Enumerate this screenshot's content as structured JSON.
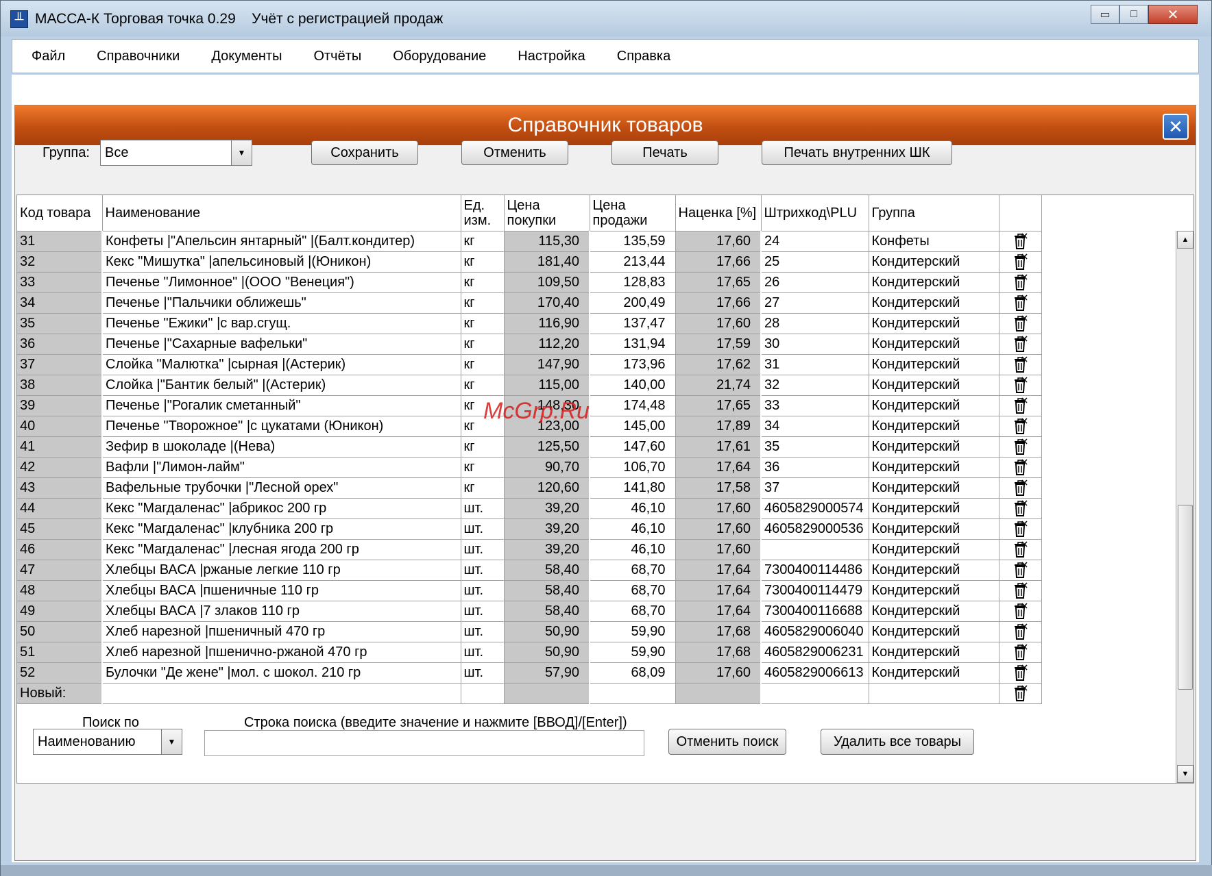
{
  "window": {
    "title": "МАССА-К Торговая точка 0.29    Учёт с регистрацией продаж",
    "app_icon_glyph": "╨",
    "controls": {
      "minimize": "▭",
      "maximize": "□",
      "close": "✕"
    }
  },
  "menu": [
    "Файл",
    "Справочники",
    "Документы",
    "Отчёты",
    "Оборудование",
    "Настройка",
    "Справка"
  ],
  "panel": {
    "title": "Справочник товаров",
    "close_glyph": "✕",
    "header_color": "#c24f12"
  },
  "toolbar": {
    "group_label": "Группа:",
    "group_value": "Все",
    "save_label": "Сохранить",
    "cancel_label": "Отменить",
    "print_label": "Печать",
    "print_barcodes_label": "Печать внутренних ШК"
  },
  "table": {
    "columns": [
      "Код товара",
      "Наименование",
      "Ед. изм.",
      "Цена покупки",
      "Цена продажи",
      "Наценка [%]",
      "Штрихкод\\PLU",
      "Группа",
      ""
    ],
    "rows": [
      {
        "code": "31",
        "name": "Конфеты |\"Апельсин янтарный\" |(Балт.кондитер)",
        "unit": "кг",
        "buy": "115,30",
        "sell": "135,59",
        "markup": "17,60",
        "barcode": "24",
        "group": "Конфеты"
      },
      {
        "code": "32",
        "name": "Кекс \"Мишутка\" |апельсиновый |(Юникон)",
        "unit": "кг",
        "buy": "181,40",
        "sell": "213,44",
        "markup": "17,66",
        "barcode": "25",
        "group": "Кондитерский"
      },
      {
        "code": "33",
        "name": "Печенье \"Лимонное\" |(ООО \"Венеция\")",
        "unit": "кг",
        "buy": "109,50",
        "sell": "128,83",
        "markup": "17,65",
        "barcode": "26",
        "group": "Кондитерский"
      },
      {
        "code": "34",
        "name": "Печенье |\"Пальчики оближешь\"",
        "unit": "кг",
        "buy": "170,40",
        "sell": "200,49",
        "markup": "17,66",
        "barcode": "27",
        "group": "Кондитерский"
      },
      {
        "code": "35",
        "name": "Печенье \"Ежики\" |с вар.сгущ.",
        "unit": "кг",
        "buy": "116,90",
        "sell": "137,47",
        "markup": "17,60",
        "barcode": "28",
        "group": "Кондитерский"
      },
      {
        "code": "36",
        "name": "Печенье |\"Сахарные вафельки\"",
        "unit": "кг",
        "buy": "112,20",
        "sell": "131,94",
        "markup": "17,59",
        "barcode": "30",
        "group": "Кондитерский"
      },
      {
        "code": "37",
        "name": "Слойка \"Малютка\" |сырная |(Астерик)",
        "unit": "кг",
        "buy": "147,90",
        "sell": "173,96",
        "markup": "17,62",
        "barcode": "31",
        "group": "Кондитерский"
      },
      {
        "code": "38",
        "name": "Слойка |\"Бантик белый\" |(Астерик)",
        "unit": "кг",
        "buy": "115,00",
        "sell": "140,00",
        "markup": "21,74",
        "barcode": "32",
        "group": "Кондитерский"
      },
      {
        "code": "39",
        "name": "Печенье |\"Рогалик сметанный\"",
        "unit": "кг",
        "buy": "148,30",
        "sell": "174,48",
        "markup": "17,65",
        "barcode": "33",
        "group": "Кондитерский"
      },
      {
        "code": "40",
        "name": "Печенье \"Творожное\" |с цукатами (Юникон)",
        "unit": "кг",
        "buy": "123,00",
        "sell": "145,00",
        "markup": "17,89",
        "barcode": "34",
        "group": "Кондитерский"
      },
      {
        "code": "41",
        "name": "Зефир в шоколаде |(Нева)",
        "unit": "кг",
        "buy": "125,50",
        "sell": "147,60",
        "markup": "17,61",
        "barcode": "35",
        "group": "Кондитерский"
      },
      {
        "code": "42",
        "name": "Вафли |\"Лимон-лайм\"",
        "unit": "кг",
        "buy": "90,70",
        "sell": "106,70",
        "markup": "17,64",
        "barcode": "36",
        "group": "Кондитерский"
      },
      {
        "code": "43",
        "name": "Вафельные трубочки |\"Лесной орех\"",
        "unit": "кг",
        "buy": "120,60",
        "sell": "141,80",
        "markup": "17,58",
        "barcode": "37",
        "group": "Кондитерский"
      },
      {
        "code": "44",
        "name": "Кекс \"Магдаленас\" |абрикос 200 гр",
        "unit": "шт.",
        "buy": "39,20",
        "sell": "46,10",
        "markup": "17,60",
        "barcode": "4605829000574",
        "group": "Кондитерский"
      },
      {
        "code": "45",
        "name": "Кекс \"Магдаленас\" |клубника 200 гр",
        "unit": "шт.",
        "buy": "39,20",
        "sell": "46,10",
        "markup": "17,60",
        "barcode": "4605829000536",
        "group": "Кондитерский"
      },
      {
        "code": "46",
        "name": "Кекс \"Магдаленас\" |лесная ягода 200 гр",
        "unit": "шт.",
        "buy": "39,20",
        "sell": "46,10",
        "markup": "17,60",
        "barcode": "",
        "group": "Кондитерский"
      },
      {
        "code": "47",
        "name": "Хлебцы ВАСА |ржаные легкие 110 гр",
        "unit": "шт.",
        "buy": "58,40",
        "sell": "68,70",
        "markup": "17,64",
        "barcode": "7300400114486",
        "group": "Кондитерский"
      },
      {
        "code": "48",
        "name": "Хлебцы ВАСА |пшеничные 110 гр",
        "unit": "шт.",
        "buy": "58,40",
        "sell": "68,70",
        "markup": "17,64",
        "barcode": "7300400114479",
        "group": "Кондитерский"
      },
      {
        "code": "49",
        "name": "Хлебцы ВАСА |7 злаков 110 гр",
        "unit": "шт.",
        "buy": "58,40",
        "sell": "68,70",
        "markup": "17,64",
        "barcode": "7300400116688",
        "group": "Кондитерский"
      },
      {
        "code": "50",
        "name": "Хлеб нарезной |пшеничный 470 гр",
        "unit": "шт.",
        "buy": "50,90",
        "sell": "59,90",
        "markup": "17,68",
        "barcode": "4605829006040",
        "group": "Кондитерский"
      },
      {
        "code": "51",
        "name": "Хлеб нарезной |пшенично-ржаной 470 гр",
        "unit": "шт.",
        "buy": "50,90",
        "sell": "59,90",
        "markup": "17,68",
        "barcode": "4605829006231",
        "group": "Кондитерский"
      },
      {
        "code": "52",
        "name": "Булочки \"Де жене\" |мол. с шокол. 210 гр",
        "unit": "шт.",
        "buy": "57,90",
        "sell": "68,09",
        "markup": "17,60",
        "barcode": "4605829006613",
        "group": "Кондитерский"
      },
      {
        "code": "Новый:",
        "name": "",
        "unit": "",
        "buy": "",
        "sell": "",
        "markup": "",
        "barcode": "",
        "group": ""
      }
    ]
  },
  "search": {
    "by_label": "Поиск по",
    "by_value": "Наименованию",
    "line_label": "Строка поиска (введите значение и нажмите [ВВОД]/[Enter])",
    "input_value": "",
    "cancel_search_label": "Отменить поиск",
    "delete_all_label": "Удалить все товары"
  },
  "watermark": "McGrp.Ru",
  "icons": {
    "delete_row": "trash-icon",
    "combo_arrow": "▼",
    "scroll_up": "▲",
    "scroll_down": "▼"
  }
}
